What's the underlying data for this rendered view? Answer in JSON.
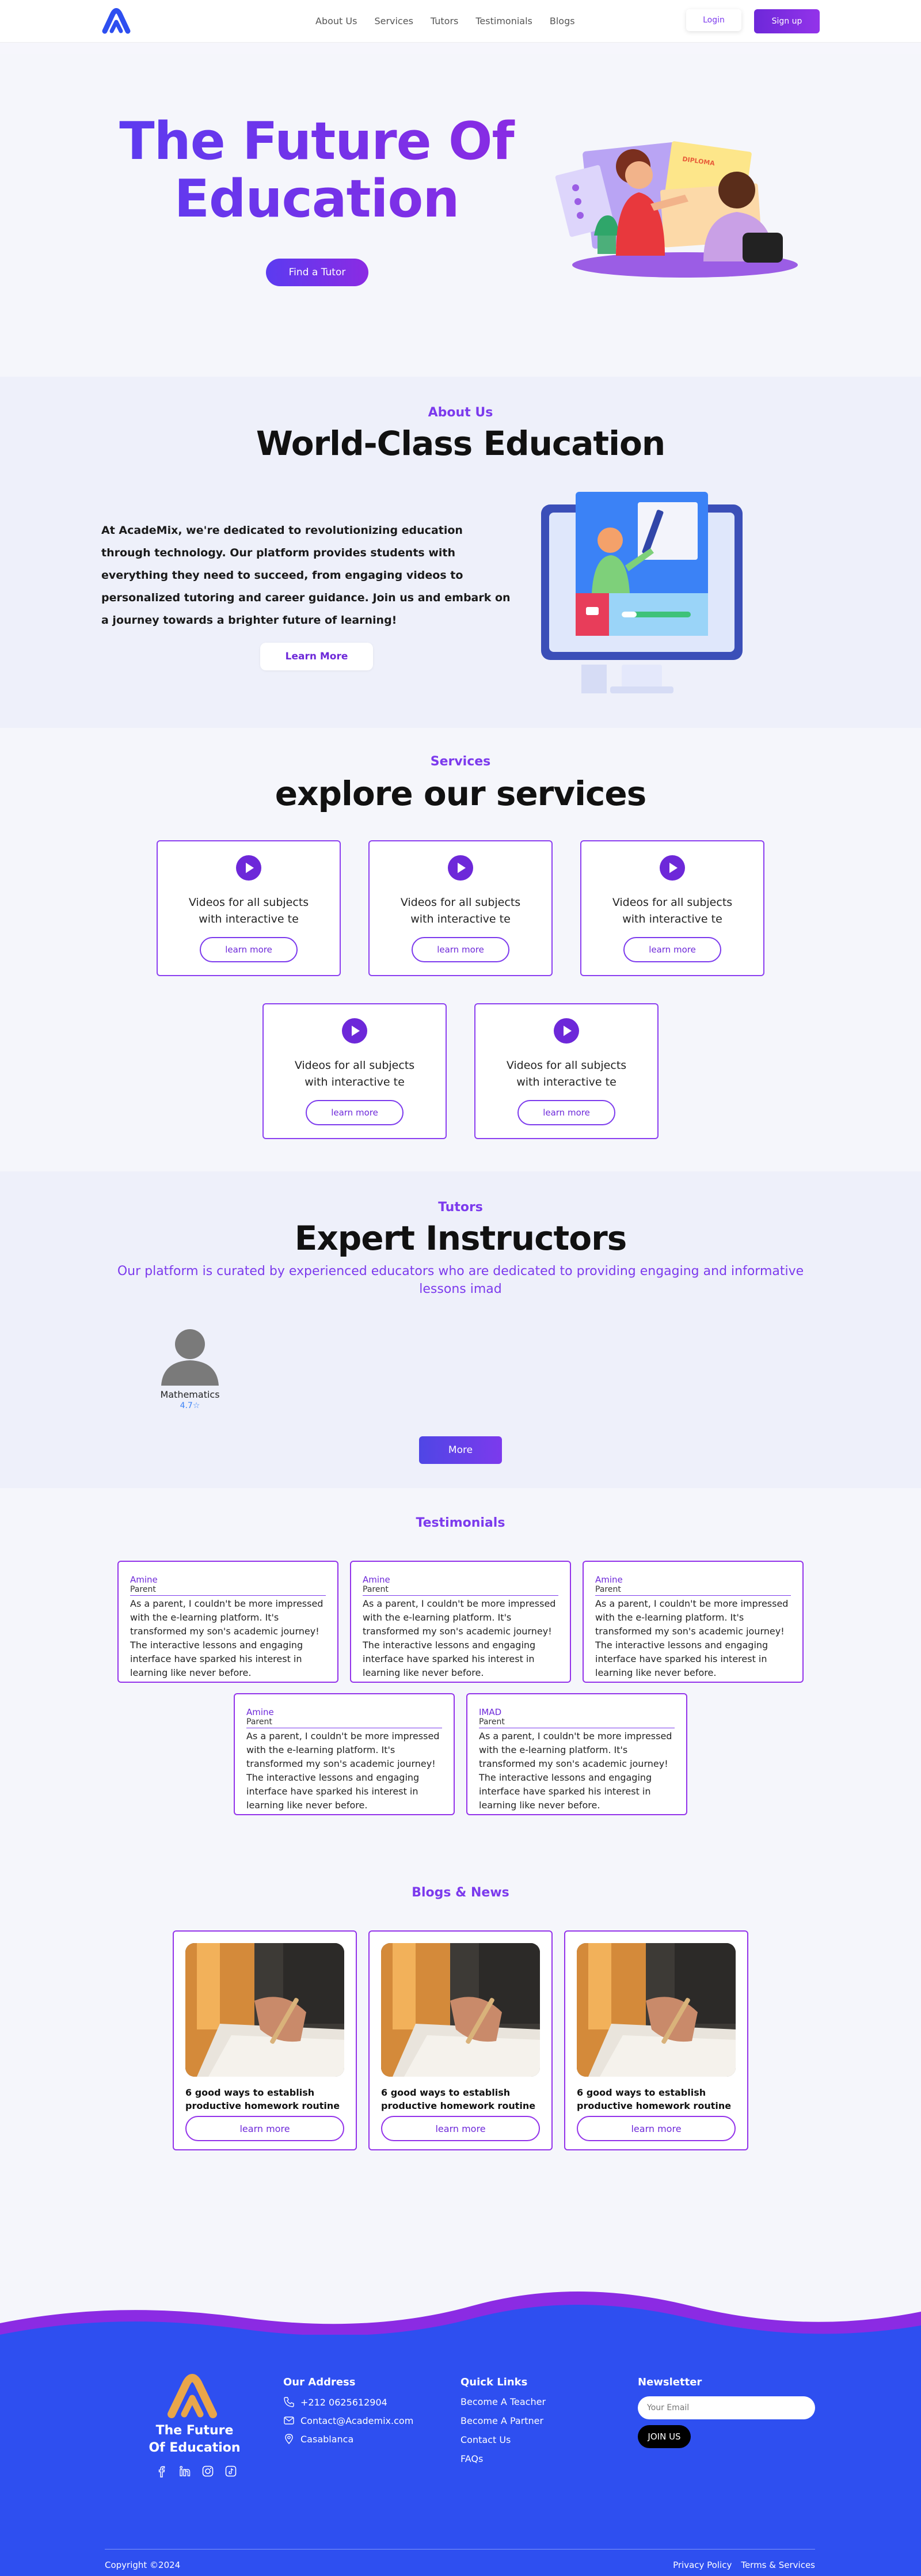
{
  "nav": {
    "links": [
      "About Us",
      "Services",
      "Tutors",
      "Testimonials",
      "Blogs"
    ],
    "login": "Login",
    "signup": "Sign up"
  },
  "hero": {
    "title": "The Future Of Education",
    "cta": "Find a Tutor",
    "certificate_text": "DIPLOMA"
  },
  "about": {
    "eyebrow": "About Us",
    "title": "World-Class Education",
    "body": "At AcadeMix, we're dedicated to revolutionizing education through technology. Our platform provides students with everything they need to succeed, from engaging videos to personalized tutoring and career guidance. Join us and embark on a journey towards a brighter future of learning!",
    "cta": "Learn More"
  },
  "services": {
    "eyebrow": "Services",
    "title": "explore our services",
    "cards": [
      {
        "text": "Videos for all subjects with interactive te",
        "button": "learn more"
      },
      {
        "text": "Videos for all subjects with interactive te",
        "button": "learn more"
      },
      {
        "text": "Videos for all subjects with interactive te",
        "button": "learn more"
      },
      {
        "text": "Videos for all subjects with interactive te",
        "button": "learn more"
      },
      {
        "text": "Videos for all subjects with interactive te",
        "button": "learn more"
      }
    ]
  },
  "tutors": {
    "eyebrow": "Tutors",
    "title": "Expert Instructors",
    "subtitle": "Our platform is curated by experienced educators who are dedicated to providing engaging and informative lessons imad",
    "items": [
      {
        "subject": "Mathematics",
        "rating": "4.7☆"
      }
    ],
    "more": "More"
  },
  "testimonials": {
    "eyebrow": "Testimonials",
    "items": [
      {
        "name": "Amine",
        "role": "Parent",
        "quote": "As a parent, I couldn't be more impressed with the e-learning platform. It's transformed my son's academic journey! The interactive lessons and engaging interface have sparked his interest in learning like never before."
      },
      {
        "name": "Amine",
        "role": "Parent",
        "quote": "As a parent, I couldn't be more impressed with the e-learning platform. It's transformed my son's academic journey! The interactive lessons and engaging interface have sparked his interest in learning like never before."
      },
      {
        "name": "Amine",
        "role": "Parent",
        "quote": "As a parent, I couldn't be more impressed with the e-learning platform. It's transformed my son's academic journey! The interactive lessons and engaging interface have sparked his interest in learning like never before."
      },
      {
        "name": "Amine",
        "role": "Parent",
        "quote": "As a parent, I couldn't be more impressed with the e-learning platform. It's transformed my son's academic journey! The interactive lessons and engaging interface have sparked his interest in learning like never before."
      },
      {
        "name": "IMAD",
        "role": "Parent",
        "quote": "As a parent, I couldn't be more impressed with the e-learning platform. It's transformed my son's academic journey! The interactive lessons and engaging interface have sparked his interest in learning like never before."
      }
    ]
  },
  "blogs": {
    "eyebrow": "Blogs & News",
    "items": [
      {
        "title": "6 good ways to establish productive homework routine",
        "button": "learn more"
      },
      {
        "title": "6 good ways to establish productive homework routine",
        "button": "learn more"
      },
      {
        "title": "6 good ways to establish productive homework routine",
        "button": "learn more"
      }
    ]
  },
  "footer": {
    "brand": "The Future Of Education",
    "address_title": "Our Address",
    "phone": "+212 0625612904",
    "email": "Contact@Academix.com",
    "city": "Casablanca",
    "quick_title": "Quick Links",
    "quick_links": [
      "Become A Teacher",
      "Become A Partner",
      "Contact Us",
      "FAQs"
    ],
    "newsletter_title": "Newsletter",
    "email_placeholder": "Your Email",
    "join": "JOIN US",
    "copyright": "Copyright ©2024",
    "privacy": "Privacy Policy",
    "terms": "Terms & Services"
  },
  "colors": {
    "brand_purple": "#7c3aed",
    "footer_blue": "#2e4ff0",
    "wave_purple": "#8b2be3"
  }
}
